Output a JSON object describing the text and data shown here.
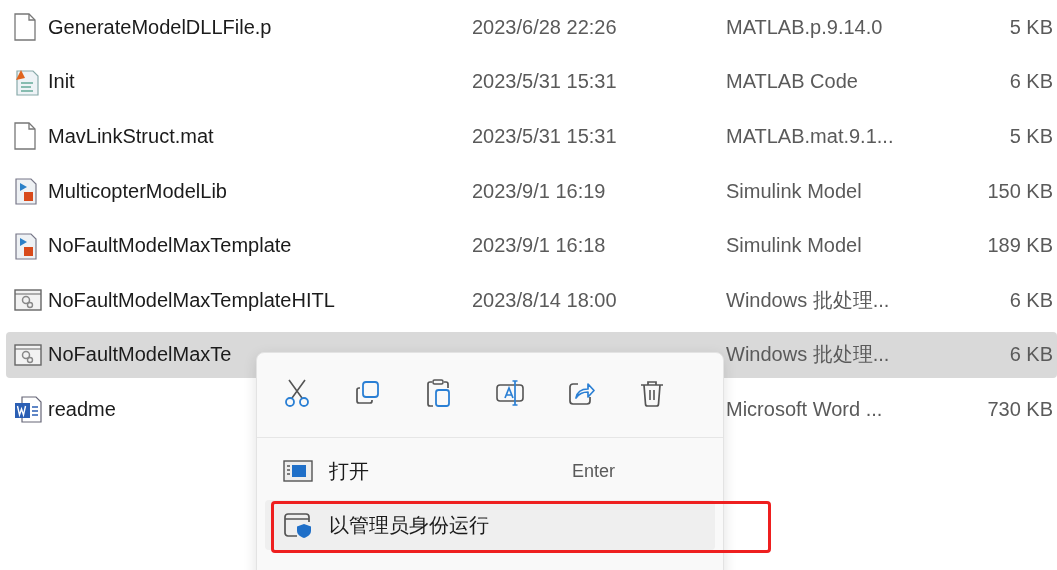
{
  "files": [
    {
      "name": "GenerateModelDLLFile.p",
      "date": "2023/6/28 22:26",
      "type": "MATLAB.p.9.14.0",
      "size": "5 KB",
      "kind": "blank",
      "selected": false
    },
    {
      "name": "Init",
      "date": "2023/5/31 15:31",
      "type": "MATLAB Code",
      "size": "6 KB",
      "kind": "matlab-code",
      "selected": false
    },
    {
      "name": "MavLinkStruct.mat",
      "date": "2023/5/31 15:31",
      "type": "MATLAB.mat.9.1...",
      "size": "5 KB",
      "kind": "blank",
      "selected": false
    },
    {
      "name": "MulticopterModelLib",
      "date": "2023/9/1 16:19",
      "type": "Simulink Model",
      "size": "150 KB",
      "kind": "simulink",
      "selected": false
    },
    {
      "name": "NoFaultModelMaxTemplate",
      "date": "2023/9/1 16:18",
      "type": "Simulink Model",
      "size": "189 KB",
      "kind": "simulink",
      "selected": false
    },
    {
      "name": "NoFaultModelMaxTemplateHITL",
      "date": "2023/8/14 18:00",
      "type": "Windows 批处理...",
      "size": "6 KB",
      "kind": "batch",
      "selected": false
    },
    {
      "name": "NoFaultModelMaxTe",
      "type": "Windows 批处理...",
      "size": "6 KB",
      "kind": "batch",
      "selected": true
    },
    {
      "name": "readme",
      "type": "Microsoft Word ...",
      "size": "730 KB",
      "kind": "word",
      "selected": false
    }
  ],
  "context_menu": {
    "toolbar": [
      {
        "kind": "cut"
      },
      {
        "kind": "copy"
      },
      {
        "kind": "paste"
      },
      {
        "kind": "rename"
      },
      {
        "kind": "share"
      },
      {
        "kind": "delete"
      }
    ],
    "items": [
      {
        "label": "打开",
        "shortcut": "Enter",
        "kind": "open",
        "highlighted": false,
        "outlined": false
      },
      {
        "label": "以管理员身份运行",
        "kind": "admin",
        "highlighted": true,
        "outlined": true
      }
    ]
  }
}
